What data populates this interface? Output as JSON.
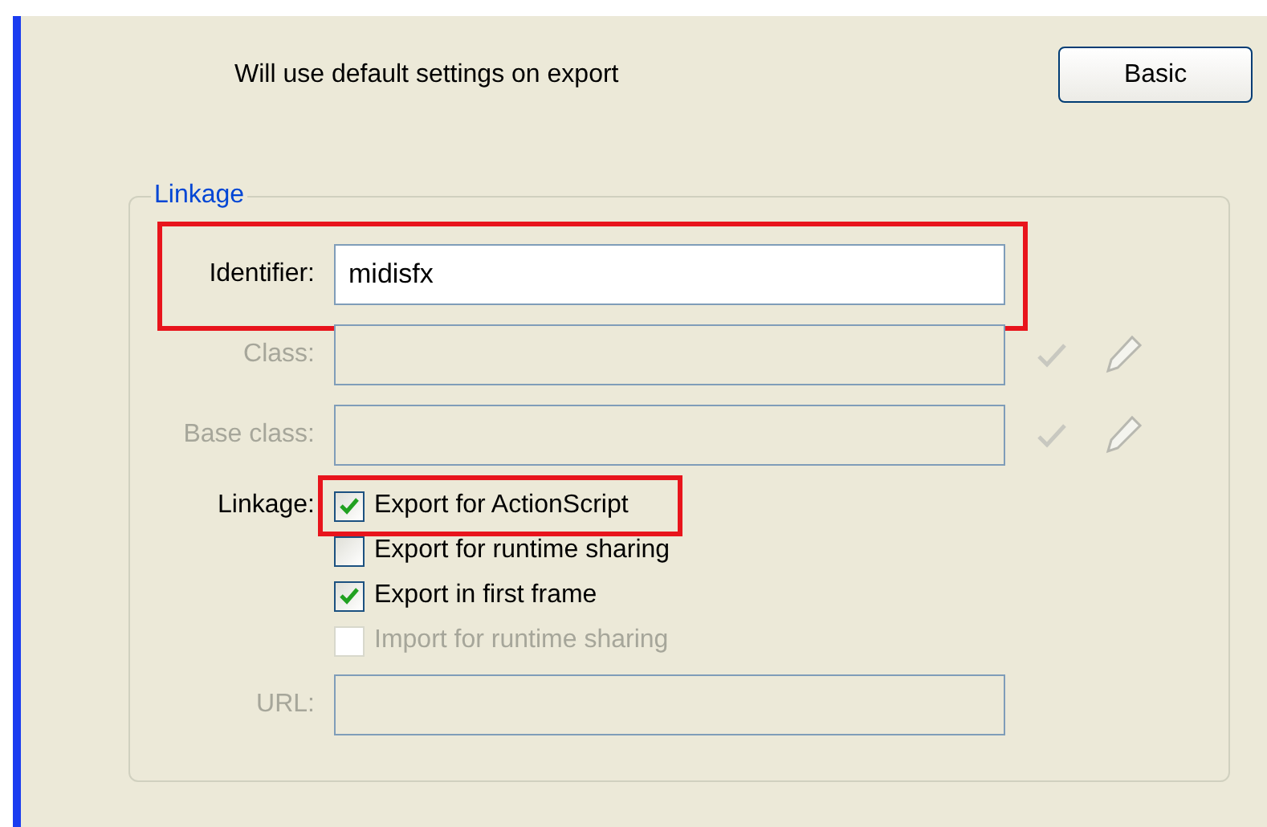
{
  "header": {
    "message": "Will use default settings on export",
    "button": "Basic"
  },
  "linkage": {
    "title": "Linkage",
    "fields": [
      {
        "label": "Identifier:",
        "value": "midisfx",
        "disabled": false,
        "highlighted": true,
        "tools": false
      },
      {
        "label": "Class:",
        "disabled": true,
        "highlighted": false,
        "tools": true
      },
      {
        "label": "Base class:",
        "disabled": true,
        "highlighted": false,
        "tools": true
      }
    ],
    "options_label": "Linkage:",
    "options": [
      {
        "label": "Export for ActionScript",
        "checked": true,
        "disabled": false,
        "highlighted": true
      },
      {
        "label": "Export for runtime sharing",
        "checked": false,
        "disabled": false,
        "highlighted": false
      },
      {
        "label": "Export in first frame",
        "checked": true,
        "disabled": false,
        "highlighted": false
      },
      {
        "label": "Import for runtime sharing",
        "checked": false,
        "disabled": true,
        "highlighted": false
      }
    ],
    "url": {
      "label": "URL:",
      "disabled": true
    }
  }
}
